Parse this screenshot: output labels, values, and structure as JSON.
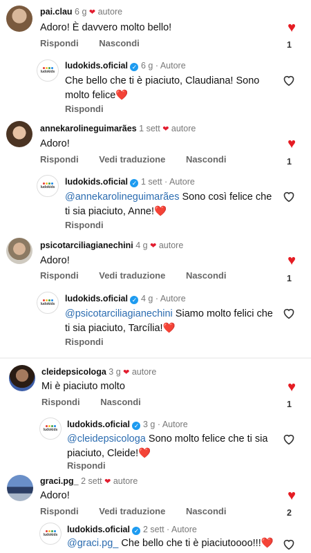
{
  "comments": [
    {
      "user": "pai.clau",
      "time": "6 g",
      "author_tag": "autore",
      "text": "Adoro! È davvero molto bello!",
      "actions": [
        "Rispondi",
        "Nascondi"
      ],
      "likes": "1",
      "reply": {
        "user": "ludokids.oficial",
        "time": "6 g",
        "author_tag": "Autore",
        "mention": "",
        "text": "Che bello che ti è piaciuto, Claudiana! Sono molto felice❤️",
        "action": "Rispondi"
      }
    },
    {
      "user": "annekarolineguimarães",
      "time": "1 sett",
      "author_tag": "autore",
      "text": "Adoro!",
      "actions": [
        "Rispondi",
        "Vedi traduzione",
        "Nascondi"
      ],
      "likes": "1",
      "reply": {
        "user": "ludokids.oficial",
        "time": "1 sett",
        "author_tag": "Autore",
        "mention": "@annekarolineguimarães",
        "text": " Sono così felice che ti sia piaciuto, Anne!❤️",
        "action": "Rispondi"
      }
    },
    {
      "user": "psicotarciliagianechini",
      "time": "4 g",
      "author_tag": "autore",
      "text": "Adoro!",
      "actions": [
        "Rispondi",
        "Vedi traduzione",
        "Nascondi"
      ],
      "likes": "1",
      "reply": {
        "user": "ludokids.oficial",
        "time": "4 g",
        "author_tag": "Autore",
        "mention": "@psicotarciliagianechini",
        "text": " Siamo molto felici che ti sia piaciuto, Tarcília!❤️",
        "action": "Rispondi"
      }
    },
    {
      "user": "cleidepsicologa",
      "time": "3 g",
      "author_tag": "autore",
      "text": "Mi è piaciuto molto",
      "actions": [
        "Rispondi",
        "Nascondi"
      ],
      "likes": "1",
      "reply": {
        "user": "ludokids.oficial",
        "time": "3 g",
        "author_tag": "Autore",
        "mention": "@cleidepsicologa",
        "text": " Sono molto felice che ti sia piaciuto, Cleide!❤️",
        "action": "Rispondi"
      }
    },
    {
      "user": "graci.pg_",
      "time": "2 sett",
      "author_tag": "autore",
      "text": "Adoro!",
      "actions": [
        "Rispondi",
        "Vedi traduzione",
        "Nascondi"
      ],
      "likes": "2",
      "reply": {
        "user": "ludokids.oficial",
        "time": "2 sett",
        "author_tag": "Autore",
        "mention": "@graci.pg_",
        "text": "  Che bello che ti è piaciutoooo!!!❤️",
        "action": ""
      }
    }
  ],
  "logo_text": "ludokids",
  "icons": {
    "like_filled": "heart-filled-icon",
    "like_empty": "heart-outline-icon",
    "verified": "verified-badge-icon"
  },
  "colors": {
    "heart": "#e51c23",
    "mention": "#2b6cb0",
    "verified": "#1d9bf0"
  }
}
